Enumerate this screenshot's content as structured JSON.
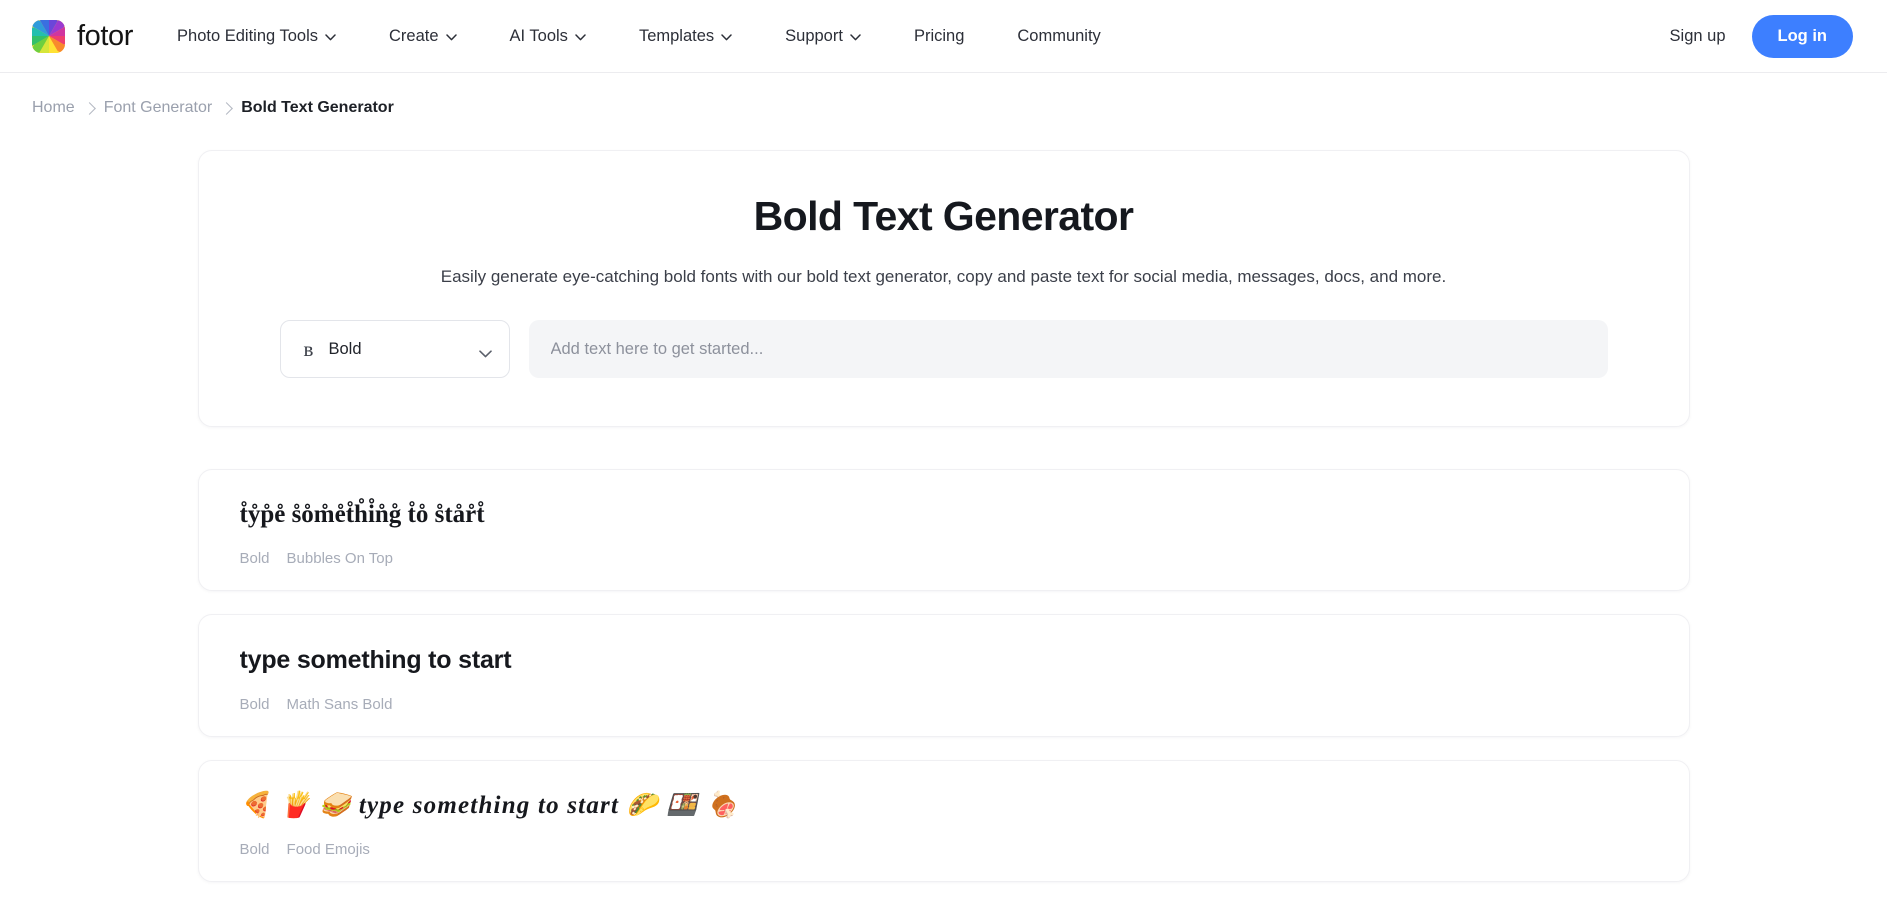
{
  "nav": {
    "brand": "fotor",
    "logo_icon": "fotor-pinwheel-logo",
    "items": [
      {
        "label": "Photo Editing Tools",
        "has_chevron": true,
        "icon": "chevron-down-icon"
      },
      {
        "label": "Create",
        "has_chevron": true,
        "icon": "chevron-down-icon"
      },
      {
        "label": "AI Tools",
        "has_chevron": true,
        "icon": "chevron-down-icon"
      },
      {
        "label": "Templates",
        "has_chevron": true,
        "icon": "chevron-down-icon"
      },
      {
        "label": "Support",
        "has_chevron": true,
        "icon": "chevron-down-icon"
      },
      {
        "label": "Pricing",
        "has_chevron": false,
        "icon": ""
      },
      {
        "label": "Community",
        "has_chevron": false,
        "icon": ""
      }
    ],
    "signup_label": "Sign up",
    "login_label": "Log in",
    "login_color": "#3d7fff"
  },
  "breadcrumb": {
    "items": [
      "Home",
      "Font Generator",
      "Bold Text Generator"
    ],
    "separator_icon": "chevron-right-icon"
  },
  "hero": {
    "title": "Bold Text Generator",
    "subtitle": "Easily generate eye-catching bold fonts with our bold text generator, copy and paste text for social media, messages, docs, and more.",
    "style_select": {
      "icon": "bold-b-icon",
      "icon_glyph": "ʙ",
      "value": "Bold",
      "chevron_icon": "chevron-down-icon"
    },
    "input": {
      "placeholder": "Add text here to get started...",
      "value": ""
    }
  },
  "results": [
    {
      "text": "t̊ẙp̊e̊ s̊o̊m̊e̊t̊h̊i̊n̊g̊ t̊o̊ s̊tår̊t̊",
      "plain_text": "type something to start",
      "style_class": "serif-bold",
      "tags": [
        "Bold",
        "Bubbles On Top"
      ]
    },
    {
      "text": "type something to start",
      "plain_text": "type something to start",
      "style_class": "sans-bold",
      "tags": [
        "Bold",
        "Math Sans Bold"
      ]
    },
    {
      "text": "🍕 🍟 🥪 type something to start 🌮 🍱 🍖",
      "plain_text": "type something to start",
      "style_class": "script-bold",
      "tags": [
        "Bold",
        "Food Emojis"
      ]
    }
  ]
}
